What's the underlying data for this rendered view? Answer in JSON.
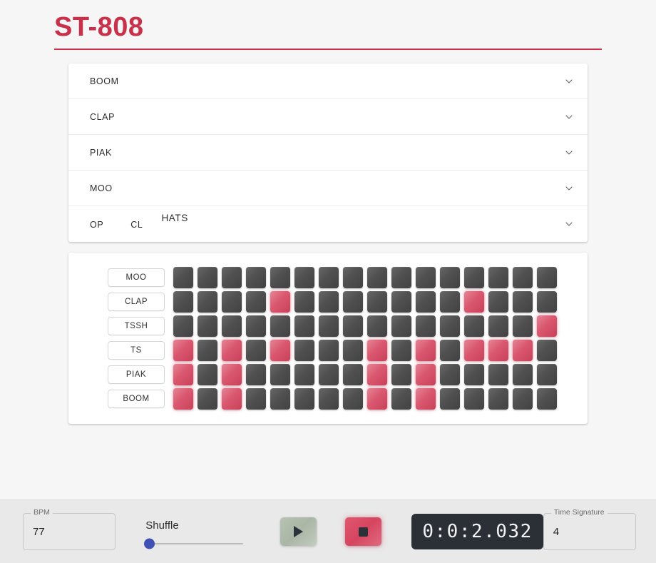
{
  "header": {
    "title": "ST-808"
  },
  "accordion": {
    "rows": [
      {
        "label": "BOOM",
        "icon": "chevron-down-icon"
      },
      {
        "label": "CLAP",
        "icon": "chevron-down-icon"
      },
      {
        "label": "PIAK",
        "icon": "chevron-down-icon"
      },
      {
        "label": "MOO",
        "icon": "chevron-down-icon"
      }
    ],
    "hats_row": {
      "open_label": "OP",
      "closed_label": "CL",
      "name": "HATS",
      "icon": "chevron-down-icon"
    }
  },
  "sequencer": {
    "steps_per_row": 16,
    "tracks": [
      {
        "name": "MOO",
        "steps": [
          0,
          0,
          0,
          0,
          0,
          0,
          0,
          0,
          0,
          0,
          0,
          0,
          0,
          0,
          0,
          0
        ]
      },
      {
        "name": "CLAP",
        "steps": [
          0,
          0,
          0,
          0,
          1,
          0,
          0,
          0,
          0,
          0,
          0,
          0,
          1,
          0,
          0,
          0
        ]
      },
      {
        "name": "TSSH",
        "steps": [
          0,
          0,
          0,
          0,
          0,
          0,
          0,
          0,
          0,
          0,
          0,
          0,
          0,
          0,
          0,
          1
        ]
      },
      {
        "name": "TS",
        "steps": [
          1,
          0,
          1,
          0,
          1,
          0,
          0,
          0,
          1,
          0,
          1,
          0,
          1,
          1,
          1,
          0
        ]
      },
      {
        "name": "PIAK",
        "steps": [
          1,
          0,
          1,
          0,
          0,
          0,
          0,
          0,
          1,
          0,
          1,
          0,
          0,
          0,
          0,
          0
        ]
      },
      {
        "name": "BOOM",
        "steps": [
          1,
          0,
          1,
          0,
          0,
          0,
          0,
          0,
          1,
          0,
          1,
          0,
          0,
          0,
          0,
          0
        ]
      }
    ]
  },
  "transport": {
    "bpm": {
      "label": "BPM",
      "value": "77"
    },
    "shuffle": {
      "label": "Shuffle",
      "value": 0
    },
    "play": {
      "icon": "play-icon",
      "label": "Play"
    },
    "stop": {
      "icon": "stop-icon",
      "label": "Stop"
    },
    "timer": {
      "value": "0:0:2.032"
    },
    "time_signature": {
      "label": "Time Signature",
      "value": "4"
    }
  },
  "colors": {
    "accent": "#c9304a",
    "step_on": "#d6455f",
    "step_off": "#4a4a4a",
    "slider_thumb": "#3f51b5",
    "timer_bg": "#2b2f36"
  }
}
